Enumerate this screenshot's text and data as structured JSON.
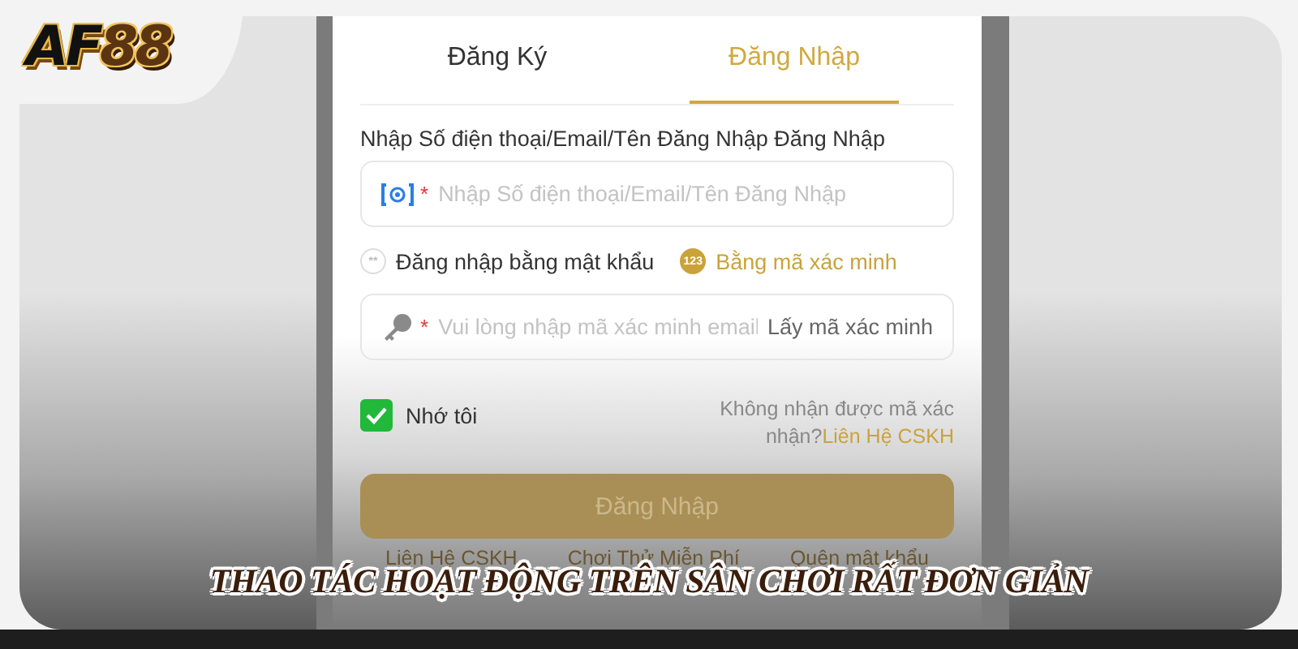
{
  "logo": {
    "letters": "AF",
    "digits": "88"
  },
  "tabs": [
    {
      "label": "Đăng Ký",
      "selected": false
    },
    {
      "label": "Đăng Nhập",
      "selected": true
    }
  ],
  "account_label": "Nhập Số điện thoại/Email/Tên Đăng Nhập Đăng Nhập",
  "account_field": {
    "required_mark": "*",
    "placeholder": "Nhập Số điện thoại/Email/Tên Đăng Nhập"
  },
  "login_modes": [
    {
      "badge": "**",
      "label": "Đăng nhập bằng mật khẩu",
      "selected": false
    },
    {
      "badge": "123",
      "label": "Bằng mã xác minh",
      "selected": true
    }
  ],
  "code_field": {
    "required_mark": "*",
    "placeholder": "Vui lòng nhập mã xác minh email",
    "action": "Lấy mã xác minh"
  },
  "remember": {
    "label": "Nhớ tôi",
    "checked": true
  },
  "help": {
    "text": "Không nhận được mã xác nhận?",
    "link": "Liên Hệ CSKH"
  },
  "submit": {
    "label": "Đăng Nhập"
  },
  "footer_links": [
    "Liên Hệ CSKH",
    "Chơi Thử Miễn Phí",
    "Quên mật khẩu"
  ],
  "caption": "THAO TÁC HOẠT ĐỘNG TRÊN SÂN CHƠI RẤT ĐƠN GIẢN"
}
